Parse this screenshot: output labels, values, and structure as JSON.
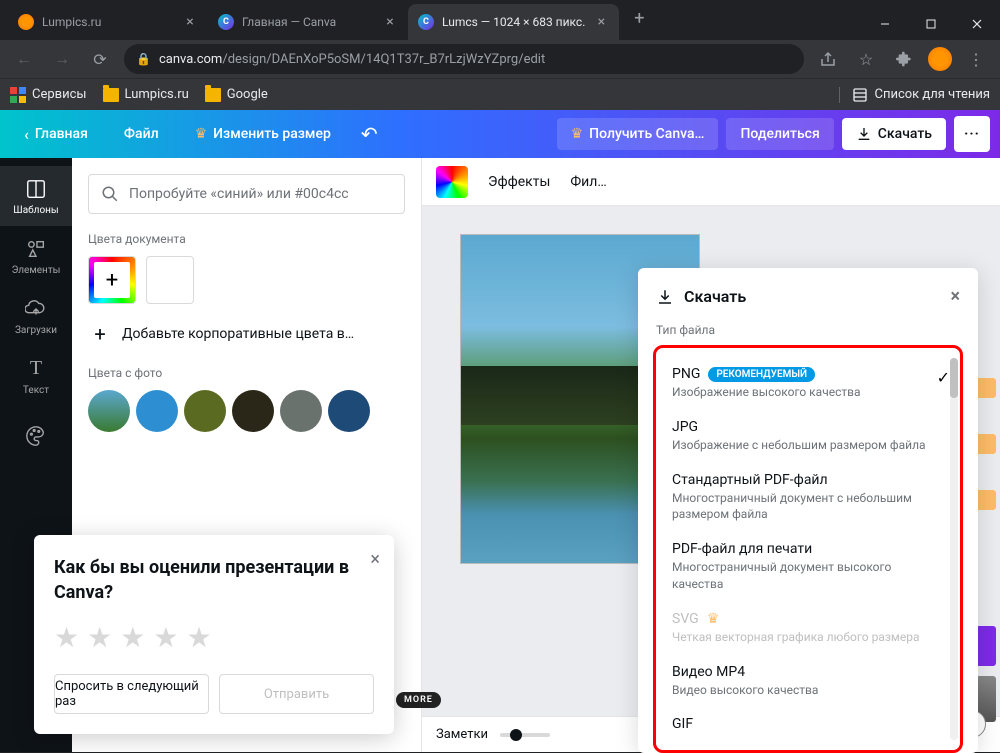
{
  "browser": {
    "tabs": [
      {
        "title": "Lumpics.ru",
        "icon": "orange"
      },
      {
        "title": "Главная — Canva",
        "icon": "canva"
      },
      {
        "title": "Lumcs — 1024 × 683 пикс.",
        "icon": "canva",
        "active": true
      }
    ],
    "url_host": "canva.com",
    "url_path": "/design/DAEnXoP5oSM/14Q1T37r_B7rLzjWzYZprg/edit",
    "bookmarks": {
      "services": "Сервисы",
      "lumpics": "Lumpics.ru",
      "google": "Google",
      "readlist": "Список для чтения"
    }
  },
  "header": {
    "home": "Главная",
    "file": "Файл",
    "resize": "Изменить размер",
    "get_pro": "Получить Canva…",
    "share": "Поделиться",
    "download": "Скачать"
  },
  "leftnav": {
    "templates": "Шаблоны",
    "elements": "Элементы",
    "uploads": "Загрузки",
    "text": "Текст"
  },
  "sidepanel": {
    "search_placeholder": "Попробуйте «синий» или #00c4cc",
    "doc_colors": "Цвета документа",
    "add_brand": "Добавьте корпоративные цвета в…",
    "photo_colors": "Цвета с фото",
    "photo_swatches": [
      "#4aa0cf",
      "#2d8fd1",
      "#5a6a20",
      "#2a2618",
      "#6a726e",
      "#1e4a78"
    ]
  },
  "editor_toolbar": {
    "effects": "Эффекты",
    "filter": "Фил…"
  },
  "download_panel": {
    "title": "Скачать",
    "filetype_label": "Тип файла",
    "items": [
      {
        "name": "PNG",
        "badge": "РЕКОМЕНДУЕМЫЙ",
        "desc": "Изображение высокого качества",
        "selected": true
      },
      {
        "name": "JPG",
        "desc": "Изображение с небольшим размером файла"
      },
      {
        "name": "Стандартный PDF-файл",
        "desc": "Многостраничный документ с небольшим размером файла"
      },
      {
        "name": "PDF-файл для печати",
        "desc": "Многостраничный документ высокого качества"
      },
      {
        "name": "SVG",
        "desc": "Четкая векторная графика любого размера",
        "pro": true,
        "disabled": true
      },
      {
        "name": "Видео MP4",
        "desc": "Видео высокого качества"
      },
      {
        "name": "GIF",
        "desc": ""
      }
    ]
  },
  "footer": {
    "notes": "Заметки"
  },
  "survey": {
    "question": "Как бы вы оценили презентации в Canva?",
    "later": "Спросить в следующий раз",
    "send": "Отправить"
  },
  "more_badge": "MORE"
}
